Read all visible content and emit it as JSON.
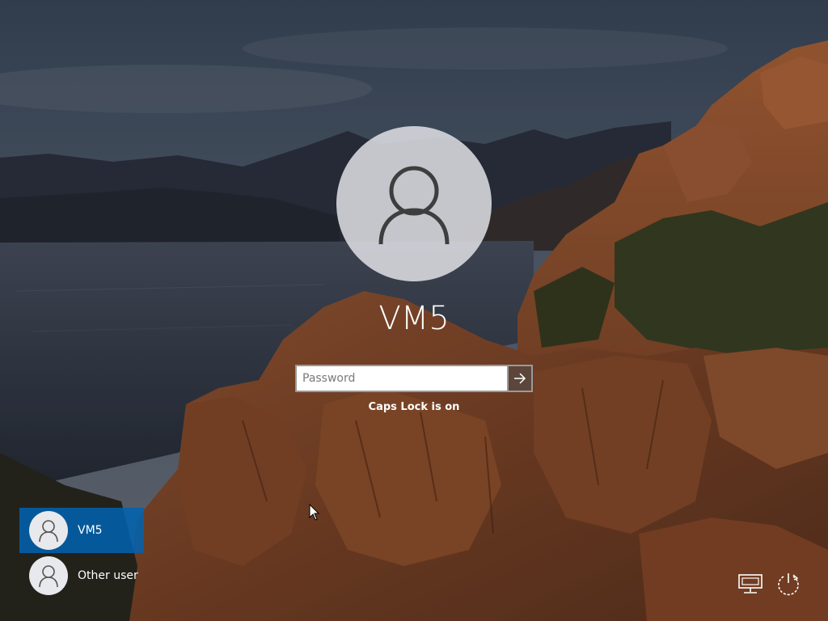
{
  "login": {
    "username": "VM5",
    "password_placeholder": "Password",
    "password_value": "",
    "caps_lock_message": "Caps Lock is on",
    "submit_icon": "arrow-right-icon",
    "avatar_icon": "user-silhouette-icon"
  },
  "users": [
    {
      "name": "VM5",
      "selected": true,
      "icon": "user-silhouette-icon"
    },
    {
      "name": "Other user",
      "selected": false,
      "icon": "user-silhouette-icon"
    }
  ],
  "system_icons": {
    "network": "network-icon",
    "power": "power-icon"
  },
  "colors": {
    "selected_user_bg": "#0063b1",
    "text": "#ffffff",
    "avatar_bg": "#e0e2e6",
    "input_border": "#9a9a9a"
  }
}
